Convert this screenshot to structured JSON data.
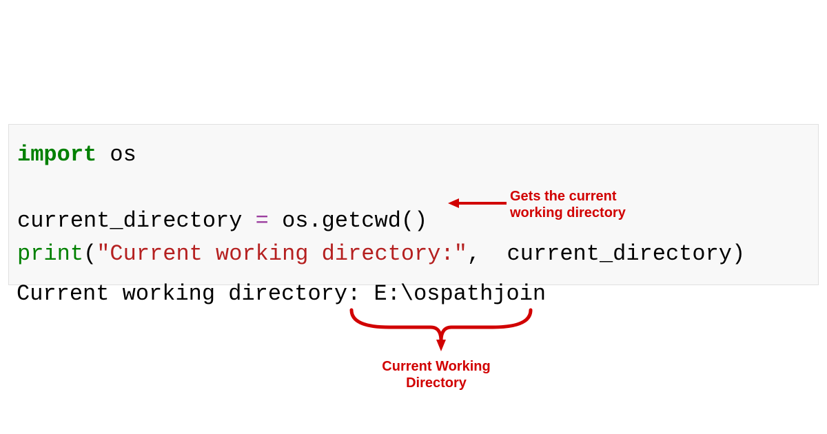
{
  "code": {
    "line1": {
      "import": "import",
      "module": " os"
    },
    "line3": {
      "var": "current_directory ",
      "eq": "=",
      "call": " os.getcwd()"
    },
    "line4": {
      "builtin": "print",
      "lparen": "(",
      "string": "\"Current working directory:\"",
      "comma": ",",
      "arg": "  current_directory",
      "rparen": ")"
    }
  },
  "output": {
    "text": "Current working directory: E:\\ospathjoin"
  },
  "annotations": {
    "gets_cwd_line1": "Gets the current",
    "gets_cwd_line2": "working directory",
    "cwd_label_line1": "Current Working",
    "cwd_label_line2": "Directory"
  },
  "colors": {
    "annotation": "#d10000",
    "keyword": "#008000",
    "string": "#b52020",
    "operator": "#9b3e9e"
  }
}
